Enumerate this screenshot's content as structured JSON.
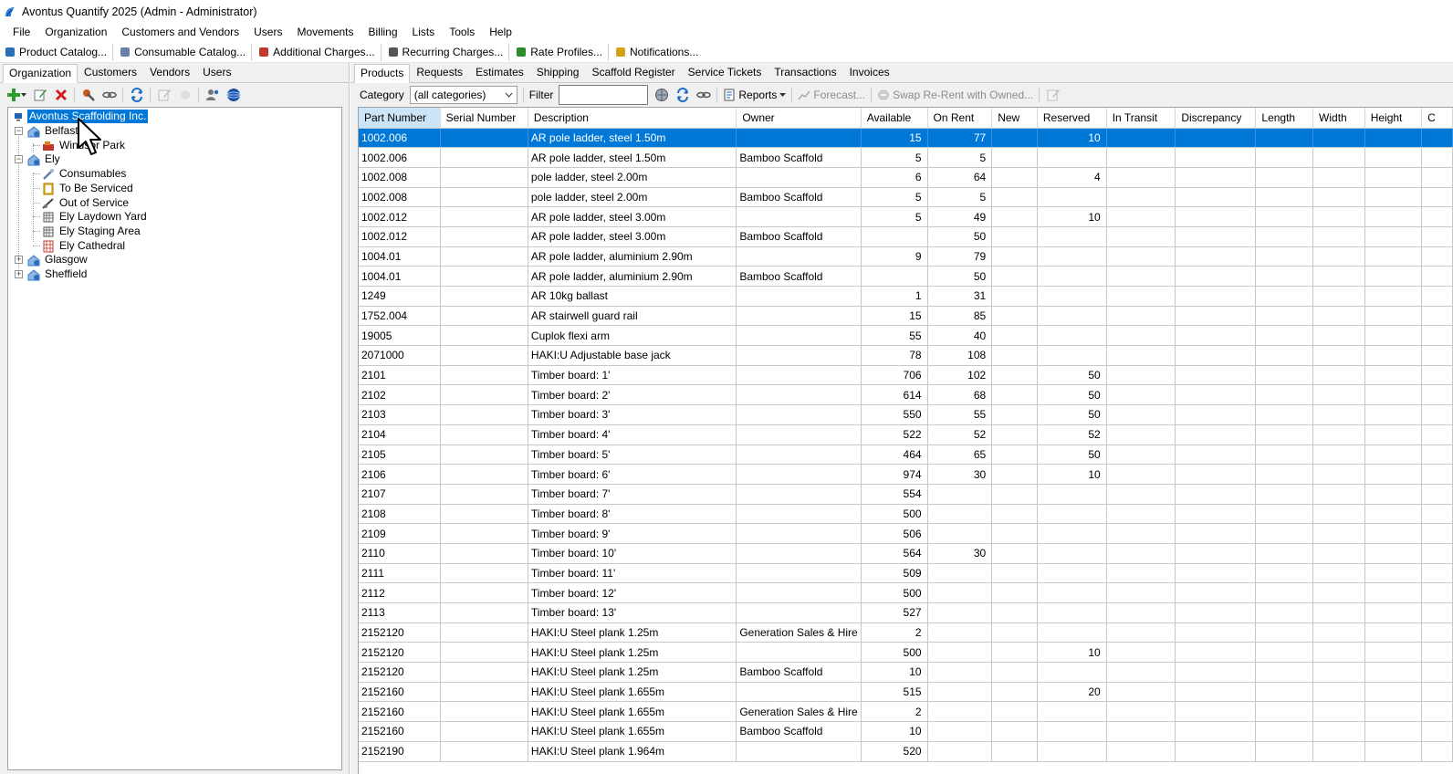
{
  "window": {
    "title": "Avontus Quantify 2025 (Admin - Administrator)"
  },
  "menu": [
    "File",
    "Organization",
    "Customers and Vendors",
    "Users",
    "Movements",
    "Billing",
    "Lists",
    "Tools",
    "Help"
  ],
  "quickbar": [
    {
      "label": "Product Catalog...",
      "icon": "book-icon",
      "color": "#2a6fb8"
    },
    {
      "label": "Consumable Catalog...",
      "icon": "wrench-icon",
      "color": "#6a7fa8"
    },
    {
      "label": "Additional Charges...",
      "icon": "charges-icon",
      "color": "#c0392b"
    },
    {
      "label": "Recurring Charges...",
      "icon": "clock-icon",
      "color": "#555555"
    },
    {
      "label": "Rate Profiles...",
      "icon": "rates-icon",
      "color": "#2e8b2e"
    },
    {
      "label": "Notifications...",
      "icon": "bell-icon",
      "color": "#d4a017"
    }
  ],
  "left": {
    "tabs": [
      "Organization",
      "Customers",
      "Vendors",
      "Users"
    ],
    "active_tab": 0,
    "tree": {
      "root": "Avontus Scaffolding Inc.",
      "belfast": "Belfast",
      "windsor": "Windsor Park",
      "ely": "Ely",
      "consumables": "Consumables",
      "serviced": "To Be Serviced",
      "out_of_service": "Out of Service",
      "laydown": "Ely Laydown Yard",
      "staging": "Ely Staging Area",
      "cathedral": "Ely Cathedral",
      "glasgow": "Glasgow",
      "sheffield": "Sheffield"
    }
  },
  "right": {
    "tabs": [
      "Products",
      "Requests",
      "Estimates",
      "Shipping",
      "Scaffold Register",
      "Service Tickets",
      "Transactions",
      "Invoices"
    ],
    "active_tab": 0,
    "filterbar": {
      "category_label": "Category",
      "category_value": "(all categories)",
      "filter_label": "Filter",
      "filter_value": "",
      "reports": "Reports",
      "forecast": "Forecast...",
      "swap": "Swap Re-Rent with Owned..."
    },
    "grid": {
      "columns": [
        "Part Number",
        "Serial Number",
        "Description",
        "Owner",
        "Available",
        "On Rent",
        "New",
        "Reserved",
        "In Transit",
        "Discrepancy",
        "Length",
        "Width",
        "Height",
        "C"
      ],
      "rows": [
        [
          "1002.006",
          "",
          "AR pole ladder, steel 1.50m",
          "",
          "15",
          "77",
          "",
          "10"
        ],
        [
          "1002.006",
          "",
          "AR pole ladder, steel 1.50m",
          "Bamboo Scaffold",
          "5",
          "5",
          "",
          ""
        ],
        [
          "1002.008",
          "",
          "pole ladder, steel 2.00m",
          "",
          "6",
          "64",
          "",
          "4"
        ],
        [
          "1002.008",
          "",
          "pole ladder, steel 2.00m",
          "Bamboo Scaffold",
          "5",
          "5",
          "",
          ""
        ],
        [
          "1002.012",
          "",
          "AR pole ladder, steel 3.00m",
          "",
          "5",
          "49",
          "",
          "10"
        ],
        [
          "1002.012",
          "",
          "AR pole ladder, steel 3.00m",
          "Bamboo Scaffold",
          "",
          "50",
          "",
          ""
        ],
        [
          "1004.01",
          "",
          "AR pole ladder, aluminium 2.90m",
          "",
          "9",
          "79",
          "",
          ""
        ],
        [
          "1004.01",
          "",
          "AR pole ladder, aluminium 2.90m",
          "Bamboo Scaffold",
          "",
          "50",
          "",
          ""
        ],
        [
          "1249",
          "",
          "AR 10kg ballast",
          "",
          "1",
          "31",
          "",
          ""
        ],
        [
          "1752.004",
          "",
          "AR stairwell guard rail",
          "",
          "15",
          "85",
          "",
          ""
        ],
        [
          "19005",
          "",
          "Cuplok flexi arm",
          "",
          "55",
          "40",
          "",
          ""
        ],
        [
          "2071000",
          "",
          "HAKI:U Adjustable base jack",
          "",
          "78",
          "108",
          "",
          ""
        ],
        [
          "2101",
          "",
          "Timber board:  1'",
          "",
          "706",
          "102",
          "",
          "50"
        ],
        [
          "2102",
          "",
          "Timber board:  2'",
          "",
          "614",
          "68",
          "",
          "50"
        ],
        [
          "2103",
          "",
          "Timber board:  3'",
          "",
          "550",
          "55",
          "",
          "50"
        ],
        [
          "2104",
          "",
          "Timber board:  4'",
          "",
          "522",
          "52",
          "",
          "52"
        ],
        [
          "2105",
          "",
          "Timber board:  5'",
          "",
          "464",
          "65",
          "",
          "50"
        ],
        [
          "2106",
          "",
          "Timber board:  6'",
          "",
          "974",
          "30",
          "",
          "10"
        ],
        [
          "2107",
          "",
          "Timber board:  7'",
          "",
          "554",
          "",
          "",
          ""
        ],
        [
          "2108",
          "",
          "Timber board:  8'",
          "",
          "500",
          "",
          "",
          ""
        ],
        [
          "2109",
          "",
          "Timber board:  9'",
          "",
          "506",
          "",
          "",
          ""
        ],
        [
          "2110",
          "",
          "Timber board:  10'",
          "",
          "564",
          "30",
          "",
          ""
        ],
        [
          "2111",
          "",
          "Timber board:  11'",
          "",
          "509",
          "",
          "",
          ""
        ],
        [
          "2112",
          "",
          "Timber board:  12'",
          "",
          "500",
          "",
          "",
          ""
        ],
        [
          "2113",
          "",
          "Timber board:  13'",
          "",
          "527",
          "",
          "",
          ""
        ],
        [
          "2152120",
          "",
          "HAKI:U Steel plank 1.25m",
          "Generation Sales & Hire",
          "2",
          "",
          "",
          ""
        ],
        [
          "2152120",
          "",
          "HAKI:U Steel plank 1.25m",
          "",
          "500",
          "",
          "",
          "10"
        ],
        [
          "2152120",
          "",
          "HAKI:U Steel plank 1.25m",
          "Bamboo Scaffold",
          "10",
          "",
          "",
          ""
        ],
        [
          "2152160",
          "",
          "HAKI:U Steel plank 1.655m",
          "",
          "515",
          "",
          "",
          "20"
        ],
        [
          "2152160",
          "",
          "HAKI:U Steel plank 1.655m",
          "Generation Sales & Hire",
          "2",
          "",
          "",
          ""
        ],
        [
          "2152160",
          "",
          "HAKI:U Steel plank 1.655m",
          "Bamboo Scaffold",
          "10",
          "",
          "",
          ""
        ],
        [
          "2152190",
          "",
          "HAKI:U Steel plank 1.964m",
          "",
          "520",
          "",
          "",
          ""
        ]
      ],
      "selected_row": 0
    }
  }
}
